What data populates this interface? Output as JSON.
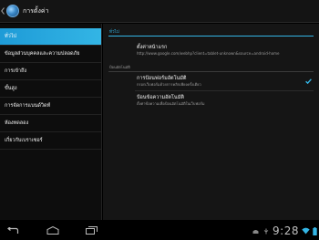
{
  "actionbar": {
    "title": "การตั้งค่า"
  },
  "sidebar": {
    "items": [
      {
        "label": "ทั่วไป",
        "active": true
      },
      {
        "label": "ข้อมูลส่วนบุคคลและความปลอดภัย",
        "active": false
      },
      {
        "label": "การเข้าถึง",
        "active": false
      },
      {
        "label": "ขั้นสูง",
        "active": false
      },
      {
        "label": "การจัดการแบนด์วิดท์",
        "active": false
      },
      {
        "label": "ห้องทดลอง",
        "active": false
      },
      {
        "label": "เกี่ยวกับเบราเซอร์",
        "active": false
      }
    ]
  },
  "content": {
    "section_header": "ทั่วไป",
    "homepage": {
      "title": "ตั้งค่าหน้าแรก",
      "summary": "http://www.google.com/webhp?client=tablet-unknown&source=android-home"
    },
    "autofill_category": "ป้อนอัตโนมัติ",
    "form_autofill": {
      "title": "การป้อนฟอร์มอัตโนมัติ",
      "summary": "กรอกเว็บฟอร์มด้วยการคลิกเพียงครั้งเดียว",
      "checked": true
    },
    "autofill_text": {
      "title": "ป้อนข้อความอัตโนมัติ",
      "summary": "ตั้งค่าข้อความเพื่อป้อนอัตโนมัติในเว็บฟอร์ม"
    }
  },
  "status": {
    "clock": "9:28"
  },
  "colors": {
    "accent": "#33b5e5",
    "background": "#000000"
  }
}
